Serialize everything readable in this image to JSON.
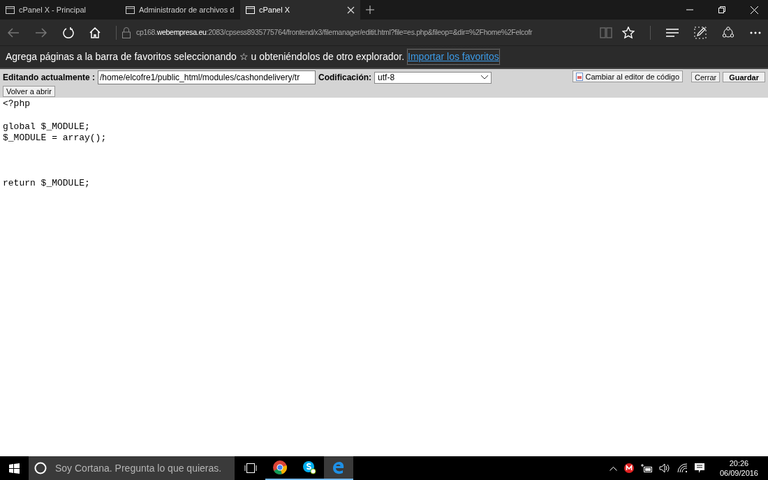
{
  "tabs": [
    {
      "label": "cPanel X - Principal",
      "selected": false
    },
    {
      "label": "Administrador de archivos d",
      "selected": false
    },
    {
      "label": "cPanel X",
      "selected": true
    }
  ],
  "address": {
    "prefix": "cp168.",
    "domain": "webempresa.eu",
    "path": ":2083/cpsess8935775764/frontend/x3/filemanager/editit.html?file=es.php&fileop=&dir=%2Fhome%2Felcofr"
  },
  "favorites_bar": {
    "message": "Agrega páginas a la barra de favoritos seleccionando ☆ u obteniéndolos de otro explorador.",
    "link": "Importar los favoritos"
  },
  "editor": {
    "editing_label": "Editando actualmente :",
    "path": "/home/elcofre1/public_html/modules/cashondelivery/tr",
    "encoding_label": "Codificación:",
    "encoding": "utf-8",
    "switch_button": "Cambiar al editor de código",
    "close_button": "Cerrar",
    "save_button": "Guardar",
    "reopen_button": "Volver a abrir",
    "code": "<?php\n\nglobal $_MODULE;\n$_MODULE = array();\n\n\n\nreturn $_MODULE;"
  },
  "taskbar": {
    "search_placeholder": "Soy Cortana. Pregunta lo que quieras.",
    "apps": [
      {
        "kind": "taskview",
        "selected": false
      },
      {
        "kind": "chrome",
        "selected": false
      },
      {
        "kind": "skype",
        "selected": false
      },
      {
        "kind": "edge",
        "selected": true
      }
    ],
    "time": "20:26",
    "date": "06/09/2016"
  }
}
